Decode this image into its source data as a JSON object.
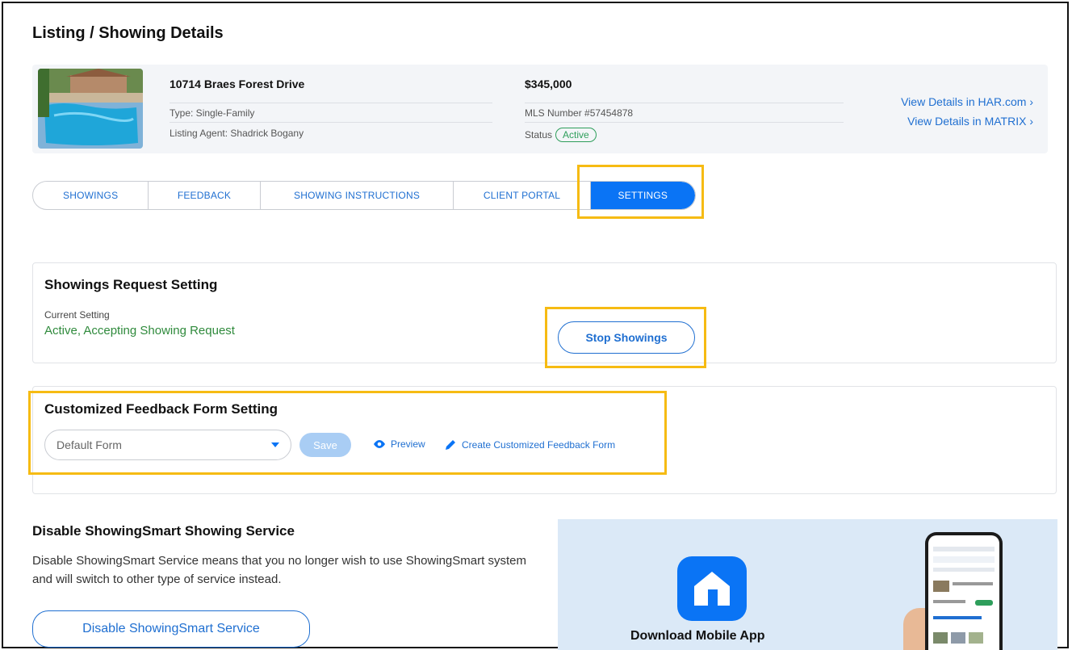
{
  "page": {
    "title": "Listing / Showing Details"
  },
  "listing": {
    "address": "10714 Braes Forest Drive",
    "type": "Type: Single-Family",
    "agent": "Listing Agent: Shadrick Bogany",
    "price": "$345,000",
    "mls": "MLS Number #57454878",
    "status_label": "Status",
    "status_value": "Active",
    "links": [
      "View Details in HAR.com ›",
      "View Details in MATRIX ›"
    ]
  },
  "tabs": [
    {
      "label": "SHOWINGS",
      "active": false
    },
    {
      "label": "FEEDBACK",
      "active": false
    },
    {
      "label": "SHOWING INSTRUCTIONS",
      "active": false
    },
    {
      "label": "CLIENT PORTAL",
      "active": false
    },
    {
      "label": "SETTINGS",
      "active": true
    }
  ],
  "showings_request": {
    "title": "Showings Request Setting",
    "current_label": "Current Setting",
    "current_value": "Active, Accepting Showing Request",
    "button": "Stop Showings"
  },
  "feedback_form": {
    "title": "Customized Feedback Form Setting",
    "selected": "Default Form",
    "save": "Save",
    "preview": "Preview",
    "create": "Create Customized Feedback Form"
  },
  "disable_service": {
    "title": "Disable ShowingSmart Showing Service",
    "description": "Disable ShowingSmart Service means that you no longer wish to use ShowingSmart system and will switch to other type of service instead.",
    "button": "Disable ShowingSmart Service"
  },
  "app_promo": {
    "label": "Download Mobile App"
  },
  "colors": {
    "accent": "#0a74f5",
    "link": "#1f6fd1",
    "success": "#2f8a3c",
    "highlight": "#f6bb13"
  }
}
